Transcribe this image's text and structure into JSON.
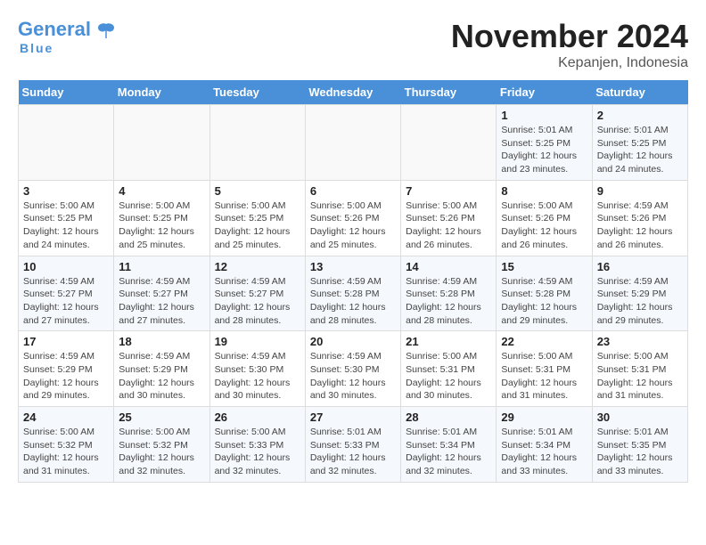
{
  "logo": {
    "name_general": "General",
    "name_blue": "Blue",
    "tagline": "Blue"
  },
  "header": {
    "month_title": "November 2024",
    "location": "Kepanjen, Indonesia"
  },
  "weekdays": [
    "Sunday",
    "Monday",
    "Tuesday",
    "Wednesday",
    "Thursday",
    "Friday",
    "Saturday"
  ],
  "weeks": [
    [
      {
        "day": "",
        "info": ""
      },
      {
        "day": "",
        "info": ""
      },
      {
        "day": "",
        "info": ""
      },
      {
        "day": "",
        "info": ""
      },
      {
        "day": "",
        "info": ""
      },
      {
        "day": "1",
        "info": "Sunrise: 5:01 AM\nSunset: 5:25 PM\nDaylight: 12 hours and 23 minutes."
      },
      {
        "day": "2",
        "info": "Sunrise: 5:01 AM\nSunset: 5:25 PM\nDaylight: 12 hours and 24 minutes."
      }
    ],
    [
      {
        "day": "3",
        "info": "Sunrise: 5:00 AM\nSunset: 5:25 PM\nDaylight: 12 hours and 24 minutes."
      },
      {
        "day": "4",
        "info": "Sunrise: 5:00 AM\nSunset: 5:25 PM\nDaylight: 12 hours and 25 minutes."
      },
      {
        "day": "5",
        "info": "Sunrise: 5:00 AM\nSunset: 5:25 PM\nDaylight: 12 hours and 25 minutes."
      },
      {
        "day": "6",
        "info": "Sunrise: 5:00 AM\nSunset: 5:26 PM\nDaylight: 12 hours and 25 minutes."
      },
      {
        "day": "7",
        "info": "Sunrise: 5:00 AM\nSunset: 5:26 PM\nDaylight: 12 hours and 26 minutes."
      },
      {
        "day": "8",
        "info": "Sunrise: 5:00 AM\nSunset: 5:26 PM\nDaylight: 12 hours and 26 minutes."
      },
      {
        "day": "9",
        "info": "Sunrise: 4:59 AM\nSunset: 5:26 PM\nDaylight: 12 hours and 26 minutes."
      }
    ],
    [
      {
        "day": "10",
        "info": "Sunrise: 4:59 AM\nSunset: 5:27 PM\nDaylight: 12 hours and 27 minutes."
      },
      {
        "day": "11",
        "info": "Sunrise: 4:59 AM\nSunset: 5:27 PM\nDaylight: 12 hours and 27 minutes."
      },
      {
        "day": "12",
        "info": "Sunrise: 4:59 AM\nSunset: 5:27 PM\nDaylight: 12 hours and 28 minutes."
      },
      {
        "day": "13",
        "info": "Sunrise: 4:59 AM\nSunset: 5:28 PM\nDaylight: 12 hours and 28 minutes."
      },
      {
        "day": "14",
        "info": "Sunrise: 4:59 AM\nSunset: 5:28 PM\nDaylight: 12 hours and 28 minutes."
      },
      {
        "day": "15",
        "info": "Sunrise: 4:59 AM\nSunset: 5:28 PM\nDaylight: 12 hours and 29 minutes."
      },
      {
        "day": "16",
        "info": "Sunrise: 4:59 AM\nSunset: 5:29 PM\nDaylight: 12 hours and 29 minutes."
      }
    ],
    [
      {
        "day": "17",
        "info": "Sunrise: 4:59 AM\nSunset: 5:29 PM\nDaylight: 12 hours and 29 minutes."
      },
      {
        "day": "18",
        "info": "Sunrise: 4:59 AM\nSunset: 5:29 PM\nDaylight: 12 hours and 30 minutes."
      },
      {
        "day": "19",
        "info": "Sunrise: 4:59 AM\nSunset: 5:30 PM\nDaylight: 12 hours and 30 minutes."
      },
      {
        "day": "20",
        "info": "Sunrise: 4:59 AM\nSunset: 5:30 PM\nDaylight: 12 hours and 30 minutes."
      },
      {
        "day": "21",
        "info": "Sunrise: 5:00 AM\nSunset: 5:31 PM\nDaylight: 12 hours and 30 minutes."
      },
      {
        "day": "22",
        "info": "Sunrise: 5:00 AM\nSunset: 5:31 PM\nDaylight: 12 hours and 31 minutes."
      },
      {
        "day": "23",
        "info": "Sunrise: 5:00 AM\nSunset: 5:31 PM\nDaylight: 12 hours and 31 minutes."
      }
    ],
    [
      {
        "day": "24",
        "info": "Sunrise: 5:00 AM\nSunset: 5:32 PM\nDaylight: 12 hours and 31 minutes."
      },
      {
        "day": "25",
        "info": "Sunrise: 5:00 AM\nSunset: 5:32 PM\nDaylight: 12 hours and 32 minutes."
      },
      {
        "day": "26",
        "info": "Sunrise: 5:00 AM\nSunset: 5:33 PM\nDaylight: 12 hours and 32 minutes."
      },
      {
        "day": "27",
        "info": "Sunrise: 5:01 AM\nSunset: 5:33 PM\nDaylight: 12 hours and 32 minutes."
      },
      {
        "day": "28",
        "info": "Sunrise: 5:01 AM\nSunset: 5:34 PM\nDaylight: 12 hours and 32 minutes."
      },
      {
        "day": "29",
        "info": "Sunrise: 5:01 AM\nSunset: 5:34 PM\nDaylight: 12 hours and 33 minutes."
      },
      {
        "day": "30",
        "info": "Sunrise: 5:01 AM\nSunset: 5:35 PM\nDaylight: 12 hours and 33 minutes."
      }
    ]
  ]
}
